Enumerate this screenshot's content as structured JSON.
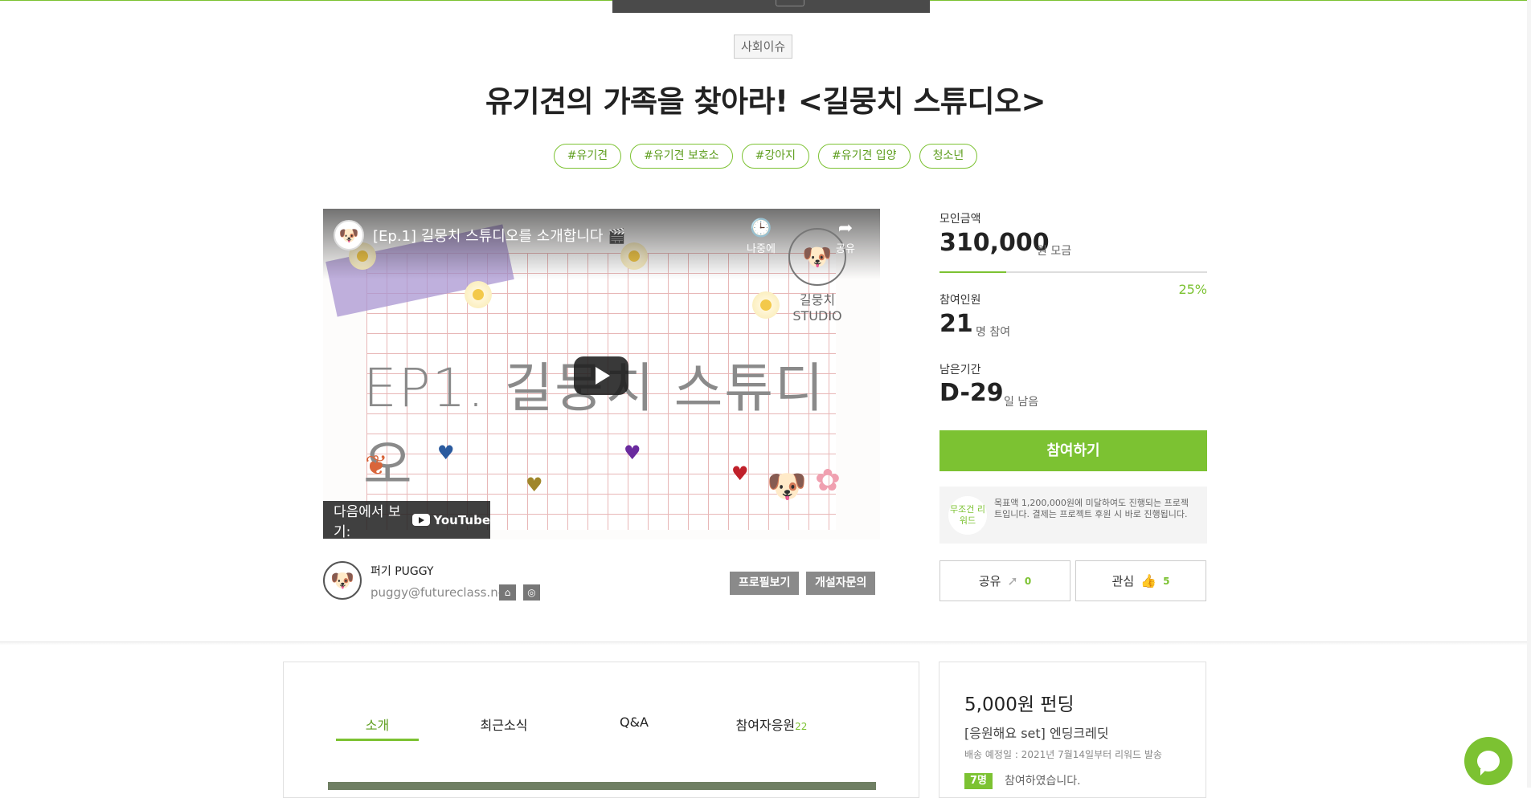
{
  "project": {
    "category": "사회이슈",
    "title": "유기견의 가족을 찾아라! <길뭉치 스튜디오>",
    "tags": [
      "#유기견",
      "#유기견 보호소",
      "#강아지",
      "#유기견 입양",
      "청소년"
    ]
  },
  "video": {
    "title": "[Ep.1] 길뭉치 스튜디오를 소개합니다 🎬",
    "watch_later": "나중에",
    "share": "공유",
    "thumbnail_text": "EP1. 길뭉치 스튜디오",
    "brand": "길뭉치 STUDIO",
    "watch_on": "다음에서 보기:",
    "youtube": "YouTube"
  },
  "creator": {
    "name": "퍼기 PUGGY",
    "email": "puggy@futureclass.net",
    "profile_button": "프로필보기",
    "contact_button": "개설자문의"
  },
  "stats": {
    "raised_label": "모인금액",
    "raised_value": "310,000",
    "raised_unit": "원 모금",
    "progress_percent": 25,
    "progress_label": "25%",
    "participants_label": "참여인원",
    "participants_value": "21",
    "participants_unit": "명 참여",
    "remaining_label": "남은기간",
    "remaining_value": "D-29",
    "remaining_unit": "일 남음"
  },
  "join_button": "참여하기",
  "notice": {
    "badge": "무조건 리워드",
    "text": "목표액 1,200,000원에 미달하여도 진행되는 프로젝트입니다. 결제는 프로젝트 후원 시 바로 진행됩니다."
  },
  "actions": {
    "share_label": "공유",
    "share_count": "0",
    "like_label": "관심",
    "like_count": "5"
  },
  "tabs": [
    {
      "label": "소개",
      "count": ""
    },
    {
      "label": "최근소식",
      "count": ""
    },
    {
      "label": "Q&A",
      "count": ""
    },
    {
      "label": "참여자응원",
      "count": "22"
    }
  ],
  "reward": {
    "price": "5,000원 펀딩",
    "name": "[응원해요 set] 엔딩크레딧",
    "shipping": "배송 예정일 : 2021년 7월14일부터 리워드 발송",
    "count": "7명",
    "count_label": "참여하였습니다."
  },
  "colors": {
    "accent": "#7cc232",
    "button_gray": "#8a8a8a"
  }
}
